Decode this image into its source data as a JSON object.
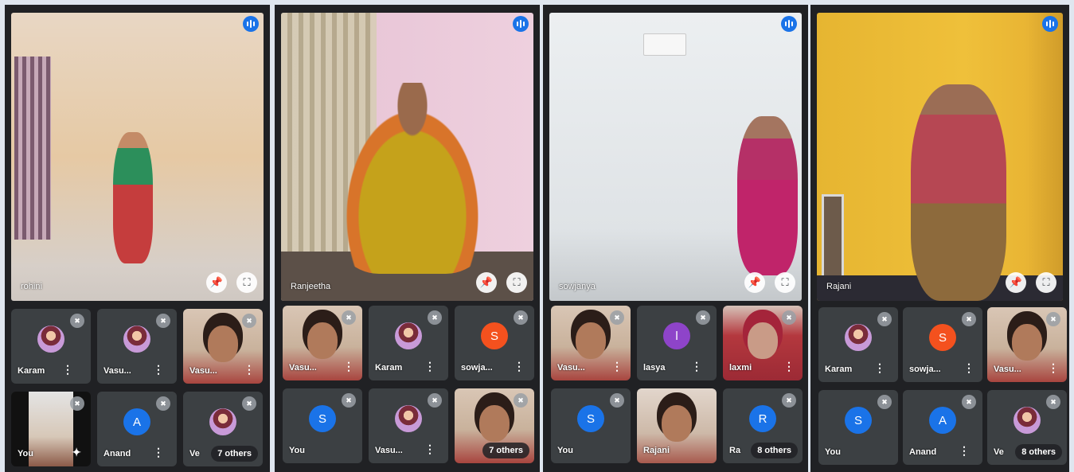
{
  "panels": [
    {
      "main_speaker": "rohini",
      "tiles": [
        {
          "label": "Karam",
          "kind": "photo-avatar"
        },
        {
          "label": "Vasu...",
          "kind": "photo-avatar"
        },
        {
          "label": "Vasu...",
          "kind": "video"
        },
        {
          "label": "You",
          "kind": "video"
        },
        {
          "label": "Anand",
          "kind": "letter",
          "letter": "A",
          "color": "#1a73e8"
        },
        {
          "label": "Ve",
          "kind": "photo-avatar",
          "others": "7 others"
        }
      ]
    },
    {
      "main_speaker": "Ranjeetha",
      "tiles": [
        {
          "label": "Vasu...",
          "kind": "video"
        },
        {
          "label": "Karam",
          "kind": "photo-avatar"
        },
        {
          "label": "sowja...",
          "kind": "letter",
          "letter": "S",
          "color": "#f4511e"
        },
        {
          "label": "You",
          "kind": "letter",
          "letter": "S",
          "color": "#1a73e8"
        },
        {
          "label": "Vasu...",
          "kind": "photo-avatar"
        },
        {
          "label": "",
          "kind": "video",
          "others": "7 others"
        }
      ]
    },
    {
      "main_speaker": "sowjanya",
      "tiles": [
        {
          "label": "Vasu...",
          "kind": "video"
        },
        {
          "label": "lasya",
          "kind": "letter",
          "letter": "l",
          "color": "#8e44c9"
        },
        {
          "label": "laxmi",
          "kind": "video"
        },
        {
          "label": "You",
          "kind": "letter",
          "letter": "S",
          "color": "#1a73e8"
        },
        {
          "label": "Rajani",
          "kind": "video"
        },
        {
          "label": "Ra",
          "kind": "letter",
          "letter": "R",
          "color": "#1a73e8",
          "others": "8 others"
        }
      ]
    },
    {
      "main_speaker": "Rajani",
      "tiles": [
        {
          "label": "Karam",
          "kind": "photo-avatar"
        },
        {
          "label": "sowja...",
          "kind": "letter",
          "letter": "S",
          "color": "#f4511e"
        },
        {
          "label": "Vasu...",
          "kind": "video"
        },
        {
          "label": "You",
          "kind": "letter",
          "letter": "S",
          "color": "#1a73e8"
        },
        {
          "label": "Anand",
          "kind": "letter",
          "letter": "A",
          "color": "#1a73e8"
        },
        {
          "label": "Ve",
          "kind": "photo-avatar",
          "others": "8 others"
        }
      ]
    }
  ],
  "icons": {
    "speaking": "audio-bars-icon",
    "pin": "pin-icon",
    "fullscreen": "fullscreen-icon",
    "mute": "mic-off-icon",
    "menu": "more-vert-icon"
  }
}
